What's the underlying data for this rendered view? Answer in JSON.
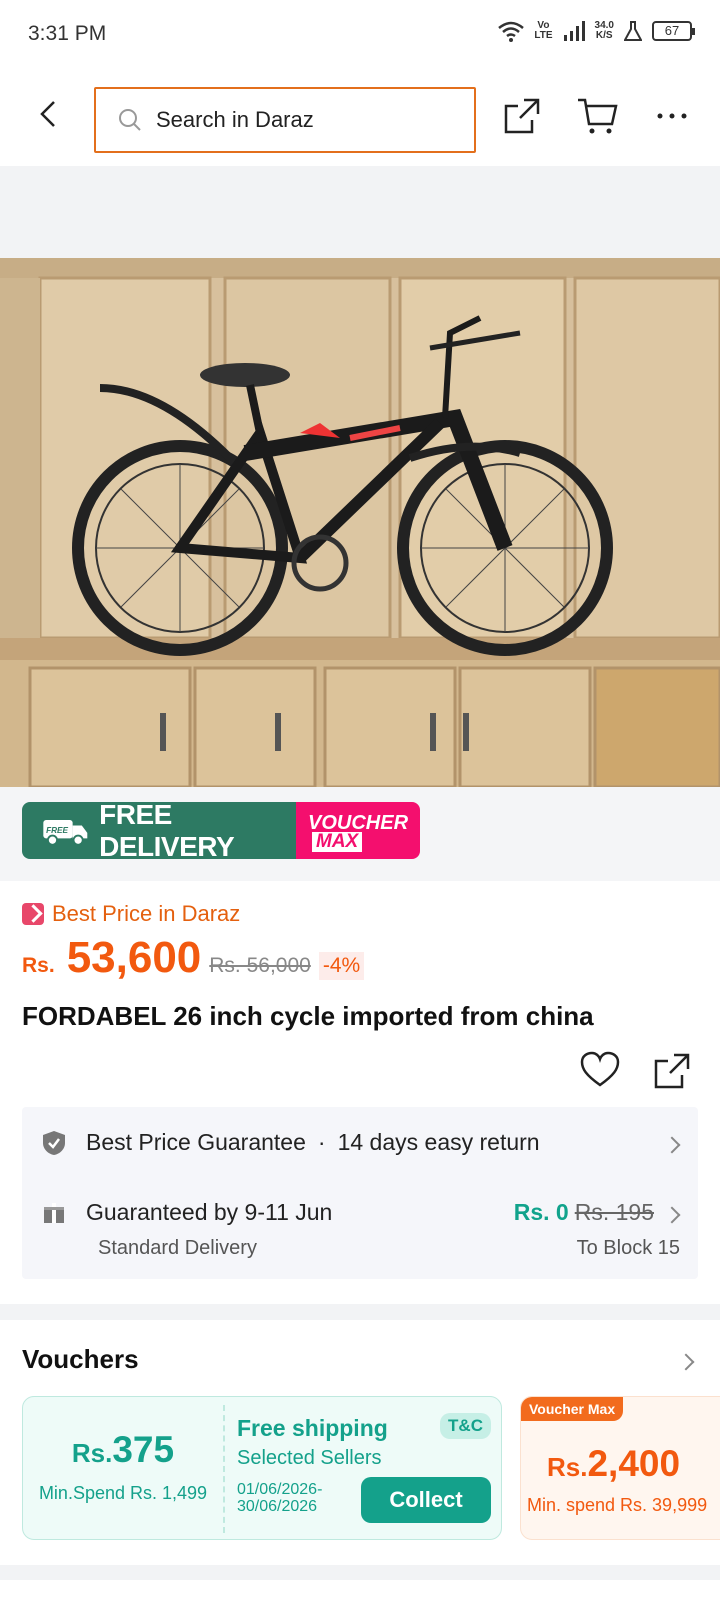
{
  "status_bar": {
    "time": "3:31 PM",
    "network_lines": [
      "Vo",
      "LTE"
    ],
    "speed_lines": [
      "34.0",
      "K/S"
    ],
    "battery": "67"
  },
  "header": {
    "search_placeholder": "Search in Daraz"
  },
  "promo": {
    "free_label": "FREE",
    "free_delivery": "FREE DELIVERY",
    "voucher": "VOUCHER",
    "max": "MAX"
  },
  "product": {
    "best_price_label": "Best Price in Daraz",
    "currency": "Rs.",
    "price": "53,600",
    "original_price": "Rs. 56,000",
    "discount": "-4%",
    "title": "FORDABEL 26 inch cycle imported from china"
  },
  "services": {
    "guarantee": "Best Price Guarantee",
    "separator": "·",
    "return_policy": "14 days easy return",
    "delivery_guarantee": "Guaranteed by 9-11 Jun",
    "delivery_type": "Standard Delivery",
    "shipping_fee": "Rs. 0",
    "shipping_fee_original": "Rs. 195",
    "destination": "To Block 15"
  },
  "vouchers": {
    "title": "Vouchers",
    "card1": {
      "currency": "Rs.",
      "amount": "375",
      "min_spend": "Min.Spend Rs. 1,499",
      "headline": "Free shipping",
      "scope": "Selected Sellers",
      "dates": "01/06/2026-30/06/2026",
      "tc": "T&C",
      "button": "Collect"
    },
    "card2": {
      "tag": "Voucher Max",
      "currency": "Rs.",
      "amount": "2,400",
      "min_spend": "Min. spend Rs. 39,999"
    }
  }
}
